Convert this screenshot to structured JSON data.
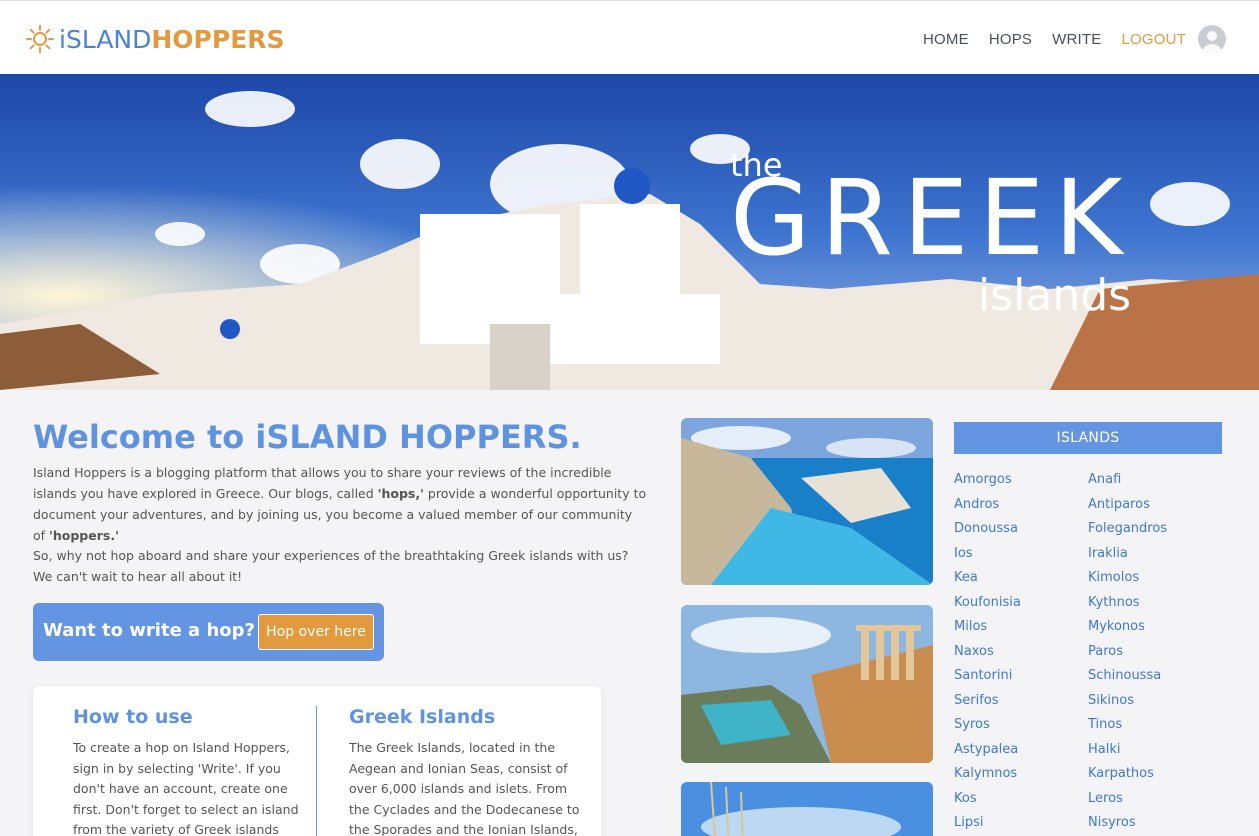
{
  "brand": {
    "part1": "iSLAND",
    "part2": "HOPPERS"
  },
  "nav": {
    "home": "HOME",
    "hops": "HOPS",
    "write": "WRITE",
    "logout": "LOGOUT"
  },
  "hero": {
    "the": "the",
    "greek": "GREEK",
    "islands": "islands"
  },
  "welcome": {
    "title": "Welcome to iSLAND HOPPERS.",
    "p1_a": "Island Hoppers is a blogging platform that allows you to share your reviews of the incredible islands you have explored in Greece. Our blogs, called ",
    "p1_b": "'hops,'",
    "p1_c": " provide a wonderful opportunity to document your adventures, and by joining us, you become a valued member of our community of ",
    "p1_d": "'hoppers.'",
    "p2": "So, why not hop aboard and share your experiences of the breathtaking Greek islands with us? We can't wait to hear all about it!"
  },
  "cta": {
    "text": "Want to write a hop?",
    "button": "Hop over here"
  },
  "info": {
    "how_title": "How to use",
    "how_text": "To create a hop on Island Hoppers, sign in by selecting 'Write'. If you don't have an account, create one first. Don't forget to select an island from the variety of Greek islands available and",
    "greek_title": "Greek Islands",
    "greek_text": "The Greek Islands, located in the Aegean and Ionian Seas, consist of over 6,000 islands and islets. From the Cyclades and the Dodecanese to the Sporades and the Ionian Islands, each"
  },
  "islands": {
    "header": "ISLANDS",
    "left": [
      "Amorgos",
      "Andros",
      "Donoussa",
      "Ios",
      "Kea",
      "Koufonisia",
      "Milos",
      "Naxos",
      "Santorini",
      "Serifos",
      "Syros",
      "Astypalea",
      "Kalymnos",
      "Kos",
      "Lipsi"
    ],
    "right": [
      "Anafi",
      "Antiparos",
      "Folegandros",
      "Iraklia",
      "Kimolos",
      "Kythnos",
      "Mykonos",
      "Paros",
      "Schinoussa",
      "Sikinos",
      "Tinos",
      "Halki",
      "Karpathos",
      "Leros",
      "Nisyros"
    ]
  },
  "colors": {
    "accent_blue": "#6495e3",
    "accent_orange": "#e39a3e",
    "link_blue": "#3f78d0"
  }
}
